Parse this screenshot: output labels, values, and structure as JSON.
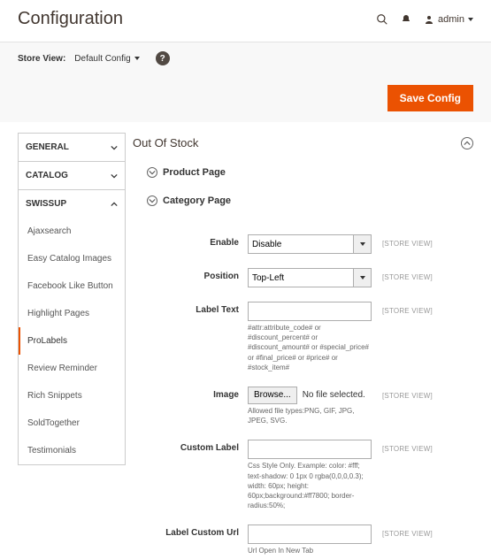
{
  "header": {
    "title": "Configuration",
    "user": "admin"
  },
  "config_bar": {
    "store_view_label": "Store View:",
    "store_view_value": "Default Config",
    "save_button": "Save Config"
  },
  "sidebar": {
    "groups": [
      {
        "label": "GENERAL",
        "open": false
      },
      {
        "label": "CATALOG",
        "open": false
      },
      {
        "label": "SWISSUP",
        "open": true
      }
    ],
    "items": [
      {
        "label": "Ajaxsearch",
        "active": false
      },
      {
        "label": "Easy Catalog Images",
        "active": false
      },
      {
        "label": "Facebook Like Button",
        "active": false
      },
      {
        "label": "Highlight Pages",
        "active": false
      },
      {
        "label": "ProLabels",
        "active": true
      },
      {
        "label": "Review Reminder",
        "active": false
      },
      {
        "label": "Rich Snippets",
        "active": false
      },
      {
        "label": "SoldTogether",
        "active": false
      },
      {
        "label": "Testimonials",
        "active": false
      }
    ]
  },
  "content": {
    "section_title": "Out Of Stock",
    "product_page_label": "Product Page",
    "category_page_label": "Category Page",
    "fields": {
      "enable": {
        "label": "Enable",
        "value": "Disable",
        "scope": "[STORE VIEW]"
      },
      "position": {
        "label": "Position",
        "value": "Top-Left",
        "scope": "[STORE VIEW]"
      },
      "label_text": {
        "label": "Label Text",
        "value": "",
        "scope": "[STORE VIEW]",
        "note": "#attr:attribute_code# or #discount_percent# or #discount_amount# or #special_price# or #final_price# or #price# or #stock_item#"
      },
      "image": {
        "label": "Image",
        "browse": "Browse...",
        "no_file": "No file selected.",
        "scope": "[STORE VIEW]",
        "note": "Allowed file types:PNG, GIF, JPG, JPEG, SVG."
      },
      "custom_label": {
        "label": "Custom Label",
        "value": "",
        "scope": "[STORE VIEW]",
        "note": "Css Style Only. Example: color: #fff; text-shadow: 0 1px 0 rgba(0,0,0,0.3); width: 60px; height: 60px;background:#ff7800; border-radius:50%;"
      },
      "label_custom_url": {
        "label": "Label Custom Url",
        "value": "",
        "scope": "[STORE VIEW]",
        "note": "Url Open In New Tab"
      }
    }
  },
  "colors": {
    "accent": "#eb5202"
  }
}
